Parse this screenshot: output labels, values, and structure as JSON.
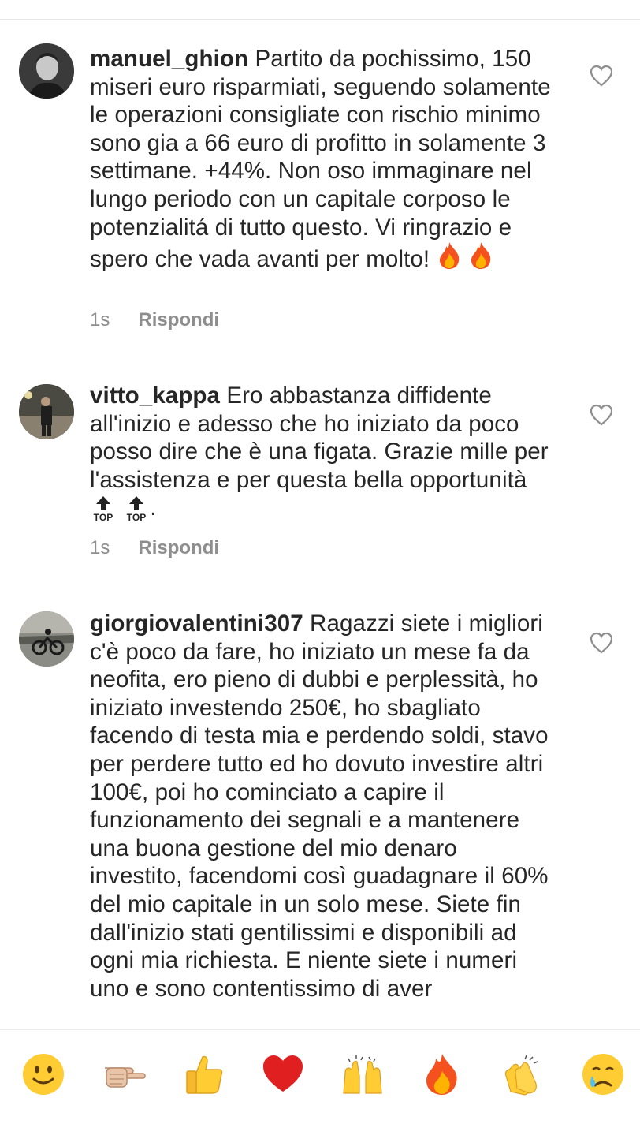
{
  "comments": [
    {
      "username": "manuel_ghion",
      "text": "Partito da pochissimo, 150 miseri euro risparmiati, seguendo solamente le operazioni consigliate con rischio minimo sono gia a 66 euro di profitto in solamente 3 settimane. +44%. Non oso immaginare nel lungo periodo con un capitale corposo le potenzialitá di tutto questo. Vi ringrazio e spero che vada avanti per molto!",
      "trailing_emoji": [
        "fire",
        "fire"
      ],
      "time": "1s",
      "reply_label": "Rispondi"
    },
    {
      "username": "vitto_kappa",
      "text": "Ero abbastanza diffidente all'inizio e adesso che ho iniziato da poco posso dire che è una figata. Grazie mille per l'assistenza e per questa bella opportunità",
      "trailing_emoji": [
        "top-arrow",
        "top-arrow"
      ],
      "trailing_text": ".",
      "badge_label": "TOP",
      "time": "1s",
      "reply_label": "Rispondi"
    },
    {
      "username": "giorgiovalentini307",
      "text": "Ragazzi siete i migliori c'è poco da fare, ho iniziato un mese fa da neofita, ero pieno di dubbi e perplessità, ho iniziato investendo 250€, ho sbagliato facendo di testa mia e perdendo soldi, stavo per perdere tutto ed ho dovuto investire altri 100€, poi ho cominciato a capire il funzionamento dei segnali e a mantenere una buona gestione del mio denaro investito, facendomi così guadagnare il 60% del mio capitale in un solo mese. Siete fin dall'inizio stati gentilissimi e disponibili ad ogni mia richiesta. E niente siete i numeri uno e sono contentissimo di aver"
    }
  ],
  "emoji_bar": [
    "slightly-smiling-face",
    "pointing-hand",
    "thumbs-up",
    "red-heart",
    "raising-hands",
    "fire",
    "clapping-hands",
    "crying-face"
  ],
  "colors": {
    "text": "#262626",
    "muted": "#8e8e8e",
    "heart_outline": "#8e8e8e",
    "fire": "#f4511e"
  }
}
